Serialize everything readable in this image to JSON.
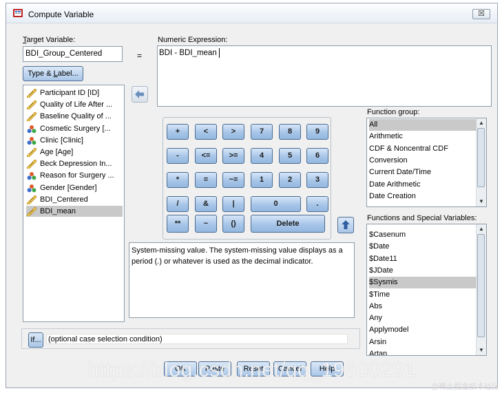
{
  "window": {
    "title": "Compute Variable",
    "close_glyph": "☒"
  },
  "target": {
    "label": "Target Variable:",
    "value": "BDI_Group_Centered",
    "equals": "="
  },
  "type_label_button": {
    "label_pre": "Type & ",
    "label_ul": "L",
    "label_post": "abel..."
  },
  "expression": {
    "label": "Numeric Expression:",
    "value": "BDI - BDI_mean"
  },
  "variables": [
    {
      "label": "Participant ID [ID]",
      "kind": "scale"
    },
    {
      "label": "Quality of Life After ...",
      "kind": "scale"
    },
    {
      "label": "Baseline Quality of ...",
      "kind": "scale"
    },
    {
      "label": "Cosmetic Surgery [...",
      "kind": "nominal"
    },
    {
      "label": "Clinic [Clinic]",
      "kind": "nominal"
    },
    {
      "label": "Age [Age]",
      "kind": "scale"
    },
    {
      "label": "Beck Depression In...",
      "kind": "scale"
    },
    {
      "label": "Reason for Surgery ...",
      "kind": "nominal"
    },
    {
      "label": "Gender [Gender]",
      "kind": "nominal"
    },
    {
      "label": "BDI_Centered",
      "kind": "scale"
    },
    {
      "label": "BDI_mean",
      "kind": "scale",
      "selected": true
    }
  ],
  "keypad": {
    "row1": [
      "+",
      "<",
      ">",
      "7",
      "8",
      "9"
    ],
    "row2": [
      "-",
      "<=",
      ">=",
      "4",
      "5",
      "6"
    ],
    "row3": [
      "*",
      "=",
      "~=",
      "1",
      "2",
      "3"
    ],
    "row4": [
      "/",
      "&",
      "|",
      "0",
      "."
    ],
    "row5": [
      "**",
      "~",
      "()",
      "Delete"
    ]
  },
  "description": "System-missing value. The system-missing value displays as a period (.) or whatever is used as the decimal indicator.",
  "function_group": {
    "label": "Function group:",
    "items": [
      "All",
      "Arithmetic",
      "CDF & Noncentral CDF",
      "Conversion",
      "Current Date/Time",
      "Date Arithmetic",
      "Date Creation"
    ],
    "selected_index": 0
  },
  "functions": {
    "label": "Functions and Special Variables:",
    "items": [
      "$Casenum",
      "$Date",
      "$Date11",
      "$JDate",
      "$Sysmis",
      "$Time",
      "Abs",
      "Any",
      "Applymodel",
      "Arsin",
      "Artan"
    ],
    "selected_index": 4
  },
  "if": {
    "button_label": "If...",
    "text": "(optional case selection condition)"
  },
  "bottom_buttons": [
    "OK",
    "Paste",
    "Reset",
    "Cancel",
    "Help"
  ],
  "watermark": "https://blog.csdn.net/qq_19600291",
  "credit": "@稀土掘金技术社区",
  "colors": {
    "selection": "#c9c9c9",
    "button_top": "#dbe9f8",
    "button_bottom": "#a9c6e8"
  }
}
